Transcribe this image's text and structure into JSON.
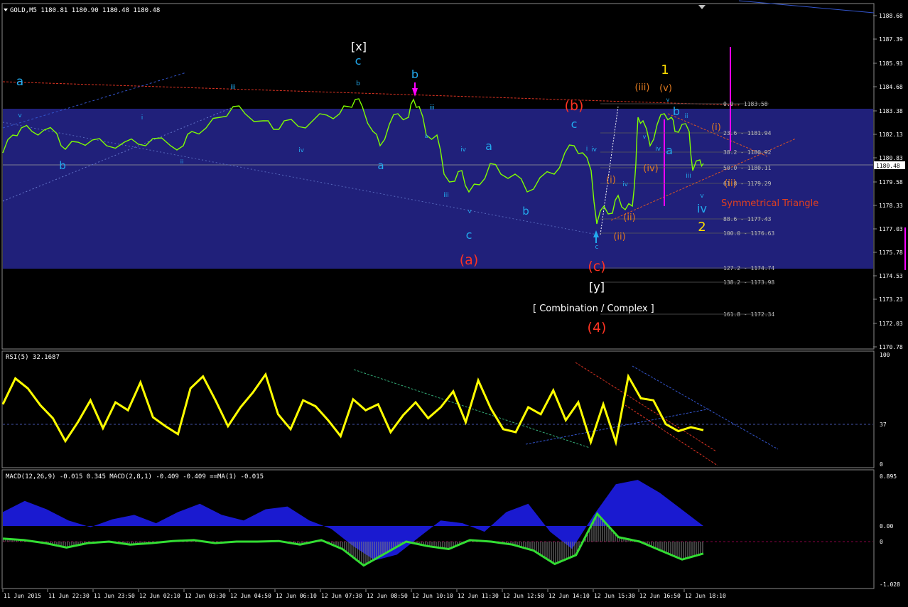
{
  "colors": {
    "background": "#000000",
    "frame": "#8a8a8a",
    "band": "#20207a",
    "price": "#7fff00",
    "rsi": "#ffff00",
    "macd_hist": "#1a1ad0",
    "macd_signal_hist": "#808080",
    "macd_line": "#33dd33",
    "wave_cyan": "#22aaee",
    "wave_red": "#ff3322",
    "wave_yellow": "#ffdd00",
    "wave_orange": "#e07a20",
    "wave_white": "#ffffff",
    "magenta": "#ff00ff"
  },
  "main_chart": {
    "header": "GOLD,M5  1180.81 1180.90 1180.48 1180.48",
    "current_price": "1180.48",
    "y_ticks": [
      "1188.68",
      "1187.39",
      "1185.93",
      "1184.68",
      "1183.38",
      "1182.13",
      "1180.83",
      "1179.58",
      "1178.33",
      "1177.03",
      "1175.78",
      "1174.53",
      "1173.23",
      "1172.03",
      "1170.78"
    ],
    "annotation_text": "Symmetrical Triangle",
    "combination_label": "[ Combination / Complex ]",
    "fib_levels": [
      "0.0 - 1183.58",
      "23.6 - 1181.94",
      "38.2 - 1180.92",
      "50.0 - 1180.11",
      "61.8 - 1179.29",
      "88.6 - 1177.43",
      "100.0 - 1176.63",
      "127.2 - 1174.74",
      "138.2 - 1173.98",
      "161.8 - 1172.34"
    ],
    "wave_labels_cyan": [
      "a",
      "b",
      "v",
      "c",
      "b",
      "i",
      "iii",
      "ii",
      "iv",
      "a",
      "b",
      "iii",
      "a",
      "iv",
      "v",
      "c",
      "b",
      "c",
      "iv",
      "i",
      "iii",
      "iv",
      "iv",
      "v",
      "a",
      "b",
      "v",
      "iii",
      "a",
      "ii",
      "iv",
      "v",
      "c"
    ],
    "wave_labels_red": [
      "(a)",
      "(b)",
      "(c)",
      "(4)"
    ],
    "wave_labels_yellow": [
      "1",
      "2"
    ],
    "wave_labels_orange": [
      "(iii)",
      "(v)",
      "(i)",
      "(iv)",
      "(ii)",
      "(ii)",
      "(i)",
      "(ii)"
    ],
    "wave_labels_white": [
      "[x]",
      "[y]"
    ]
  },
  "x_ticks": [
    "11 Jun 2015",
    "11 Jun 22:30",
    "11 Jun 23:50",
    "12 Jun 02:10",
    "12 Jun 03:30",
    "12 Jun 04:50",
    "12 Jun 06:10",
    "12 Jun 07:30",
    "12 Jun 08:50",
    "12 Jun 10:10",
    "12 Jun 11:30",
    "12 Jun 12:50",
    "12 Jun 14:10",
    "12 Jun 15:30",
    "12 Jun 16:50",
    "12 Jun 18:10"
  ],
  "rsi_panel": {
    "header": "RSI(5) 32.1687",
    "y_ticks": [
      "100",
      "37",
      "0"
    ]
  },
  "macd_panel": {
    "header": "MACD(12,26,9) -0.015 0.345  MACD(2,8,1) -0.409 -0.409  ==MA(1) -0.015",
    "y_ticks": [
      "0.895",
      "0.00",
      "0",
      "-1.028"
    ]
  },
  "chart_data": [
    {
      "type": "line",
      "title": "GOLD,M5",
      "x": [
        "11 Jun 2015",
        "11 Jun 22:30",
        "11 Jun 23:50",
        "12 Jun 02:10",
        "12 Jun 03:30",
        "12 Jun 04:50",
        "12 Jun 06:10",
        "12 Jun 07:30",
        "12 Jun 08:50",
        "12 Jun 10:10",
        "12 Jun 11:30",
        "12 Jun 12:50",
        "12 Jun 14:10",
        "12 Jun 15:30",
        "12 Jun 16:50",
        "12 Jun 18:10"
      ],
      "series": [
        {
          "name": "GOLD,M5",
          "values": [
            1181.0,
            1181.8,
            1181.3,
            1180.9,
            1182.6,
            1183.1,
            1182.8,
            1183.2,
            1181.2,
            1180.5,
            1179.6,
            1180.2,
            1180.0,
            1181.5,
            1177.6,
            1183.2,
            1182.4,
            1180.5
          ]
        }
      ],
      "ylim": [
        1170.78,
        1188.68
      ]
    },
    {
      "type": "line",
      "title": "RSI(5) 32.1687",
      "series": [
        {
          "name": "RSI(5)",
          "values": [
            58,
            84,
            74,
            57,
            44,
            21,
            40,
            62,
            34,
            60,
            52,
            80,
            45,
            36,
            28,
            74,
            86,
            62,
            36,
            55,
            70,
            88,
            48,
            33,
            62,
            56,
            42,
            26,
            63,
            52,
            58,
            30,
            47,
            60,
            44,
            55,
            71,
            40,
            82,
            54,
            33,
            30,
            55,
            48,
            72,
            42,
            60,
            20,
            58,
            20,
            86,
            64,
            62,
            38,
            31,
            35,
            32
          ]
        }
      ],
      "ylim": [
        0,
        100
      ]
    },
    {
      "type": "line",
      "title": "MACD(12,26,9)",
      "series": [
        {
          "name": "MACD(12,26,9)",
          "values": [
            0.25,
            0.45,
            0.3,
            0.1,
            -0.02,
            0.12,
            0.2,
            0.05,
            0.25,
            0.4,
            0.2,
            0.1,
            0.3,
            0.35,
            0.1,
            -0.05,
            -0.35,
            -0.6,
            -0.5,
            -0.2,
            0.1,
            0.05,
            -0.1,
            0.25,
            0.4,
            -0.1,
            -0.4,
            0.2,
            0.75,
            0.83,
            0.6,
            0.3,
            0.0
          ]
        },
        {
          "name": "MACD(2,8,1)",
          "values": [
            0.1,
            0.05,
            -0.05,
            -0.2,
            -0.05,
            0.0,
            -0.1,
            -0.05,
            0.02,
            0.05,
            -0.05,
            0.0,
            0.0,
            0.02,
            -0.1,
            0.05,
            -0.25,
            -0.8,
            -0.4,
            0.0,
            -0.15,
            -0.25,
            0.05,
            0.0,
            -0.1,
            -0.3,
            -0.75,
            -0.45,
            0.93,
            0.15,
            0.0,
            -0.3,
            -0.6,
            -0.4
          ]
        }
      ],
      "ylim": [
        -1.028,
        0.895
      ]
    }
  ]
}
